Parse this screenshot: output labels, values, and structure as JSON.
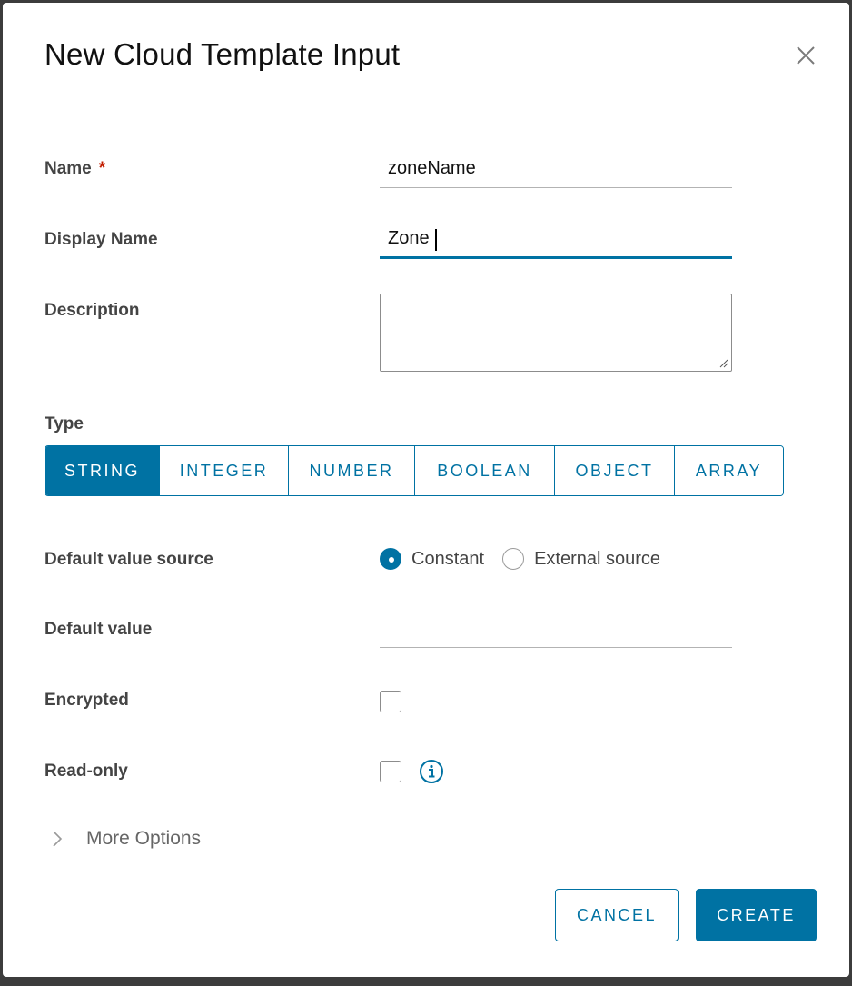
{
  "dialog": {
    "title": "New Cloud Template Input",
    "close_icon": "close-icon"
  },
  "form": {
    "name": {
      "label": "Name",
      "required_marker": "*",
      "value": "zoneName"
    },
    "display_name": {
      "label": "Display Name",
      "value": "Zone"
    },
    "description": {
      "label": "Description",
      "value": ""
    },
    "type": {
      "label": "Type",
      "options": [
        "STRING",
        "INTEGER",
        "NUMBER",
        "BOOLEAN",
        "OBJECT",
        "ARRAY"
      ],
      "selected": "STRING"
    },
    "default_value_source": {
      "label": "Default value source",
      "options": [
        "Constant",
        "External source"
      ],
      "selected": "Constant"
    },
    "default_value": {
      "label": "Default value",
      "value": ""
    },
    "encrypted": {
      "label": "Encrypted",
      "checked": false
    },
    "read_only": {
      "label": "Read-only",
      "checked": false,
      "info_icon": "info-icon"
    },
    "more_options": {
      "label": "More Options",
      "icon": "chevron-right-icon",
      "expanded": false
    }
  },
  "footer": {
    "cancel_label": "CANCEL",
    "create_label": "CREATE"
  },
  "colors": {
    "accent": "#0072a3",
    "required": "#c21d00",
    "backdrop": "#3c3c3c"
  }
}
